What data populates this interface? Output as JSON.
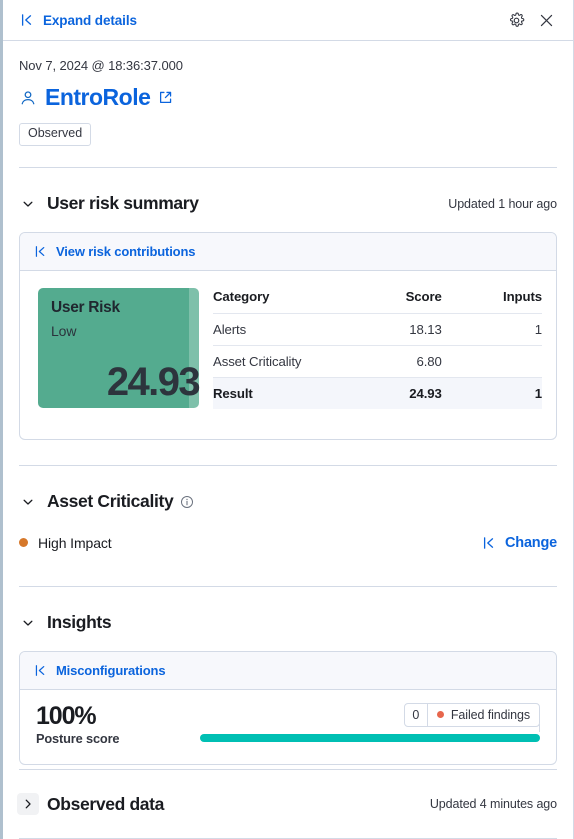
{
  "topbar": {
    "expand_label": "Expand details",
    "expand_icon": "collapse-left-icon",
    "settings_icon": "gear-icon",
    "close_icon": "close-icon"
  },
  "identity": {
    "timestamp": "Nov 7, 2024 @ 18:36:37.000",
    "user_icon": "user-icon",
    "name": "EntroRole",
    "external_link_icon": "external-link-icon",
    "badge": "Observed"
  },
  "risk_summary": {
    "title": "User risk summary",
    "updated": "Updated 1 hour ago",
    "chevron": "chevron-down-icon",
    "panel_link": "View risk contributions",
    "panel_link_icon": "collapse-left-icon",
    "score_card": {
      "label": "User Risk",
      "level": "Low",
      "value": "24.93",
      "color": "#54ab8f"
    },
    "table": {
      "headers": [
        "Category",
        "Score",
        "Inputs"
      ],
      "rows": [
        {
          "category": "Alerts",
          "score": "18.13",
          "inputs": "1"
        },
        {
          "category": "Asset Criticality",
          "score": "6.80",
          "inputs": ""
        }
      ],
      "result": {
        "category": "Result",
        "score": "24.93",
        "inputs": "1"
      }
    }
  },
  "asset_criticality": {
    "title": "Asset Criticality",
    "chevron": "chevron-down-icon",
    "info_icon": "info-icon",
    "value": "High Impact",
    "dot_color": "#d6782a",
    "change_label": "Change",
    "change_icon": "collapse-left-icon"
  },
  "insights": {
    "title": "Insights",
    "chevron": "chevron-down-icon",
    "panel_link": "Misconfigurations",
    "panel_link_icon": "collapse-left-icon",
    "posture_percent": "100%",
    "posture_caption": "Posture score",
    "failed_count": "0",
    "failed_label": "Failed findings",
    "failed_dot_color": "#e7664c",
    "bar_color": "#00bfb3",
    "bar_percent": 100
  },
  "observed_data": {
    "title": "Observed data",
    "updated": "Updated 4 minutes ago",
    "chevron": "chevron-right-icon"
  }
}
